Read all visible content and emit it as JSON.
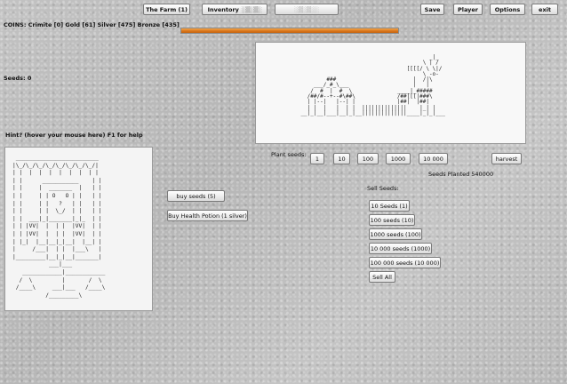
{
  "top_tabs": {
    "farm": "The Farm (1)",
    "inventory": "Inventory",
    "third_tab": ""
  },
  "top_right": {
    "save": "Save",
    "player": "Player",
    "options": "Options",
    "exit": "exit"
  },
  "coins": "COINS: Crimite [0]  Gold [61]  Silver [475]  Bronze [435]",
  "seeds": "Seeds: 0",
  "hint": "Hint? (hover your mouse here) F1 for help",
  "progress": {
    "fraction": 1.0,
    "color": "#d7741a"
  },
  "farm_art": "                                            _|_\n                                          \\ | /\n                                     [[[[/ \\ \\|/\n                                          \\ -o-\n            ###                        |  /|\\\n        ___/_#_\\___                    |   |\n       /  #  |  #  \\              ____|_#####\n      /##/#--+--#\\##\\             /##[[[|###\\\n      | |--|   |--| |             |##|  |##|\n      | |  |   |  | |  ||||||||||||||    |_| |\n    __|_|__|___|__|_|__||||||||||||||____|_|_|___",
  "plant": {
    "label": "Plant seeds:",
    "amounts": [
      "1",
      "10",
      "100",
      "1000",
      "10 000"
    ],
    "harvest": "harvest",
    "planted": "Seeds Planted 540000"
  },
  "shop": {
    "buy_seeds": "buy seeds (5)",
    "buy_potion": "Buy Health Potion (1 silver)"
  },
  "sell": {
    "label": "Sell Seeds:",
    "options": [
      "10 Seeds (1)",
      "100 seeds (10)",
      "1000 seeds (100)",
      "10 000 seeds (1000)",
      "100 000 seeds (10 000)"
    ],
    "sell_all": "Sell All"
  },
  "king_art": " _________________________\n|\\_/\\_/\\_/\\_/\\_/\\_/\\_/\\_/|\n| |  |  |  |  |  |  |  | |\n| |      ___________    | |\n| |     |  _______  |   | |\n| |     | | O   O | |   | |\n| |     | |   ?   | |   | |\n| |     | |  \\_/  | |   | |\n| |  ___|_|_______|_|_  | |\n| | |VV|  |  | |  |VV|  | |\n| | |VV|  |  | |  |VV|  | |\n| |_|  |__|__|_|__|  |__| |\n|     /___|  | |  |___\\   |\n|_________|__|_|__|_______|\n           ___|___\n   ____________|____________\n  /  \\         |       /  \\\n /____\\     ___|___   /____\\\n          /_________\\"
}
